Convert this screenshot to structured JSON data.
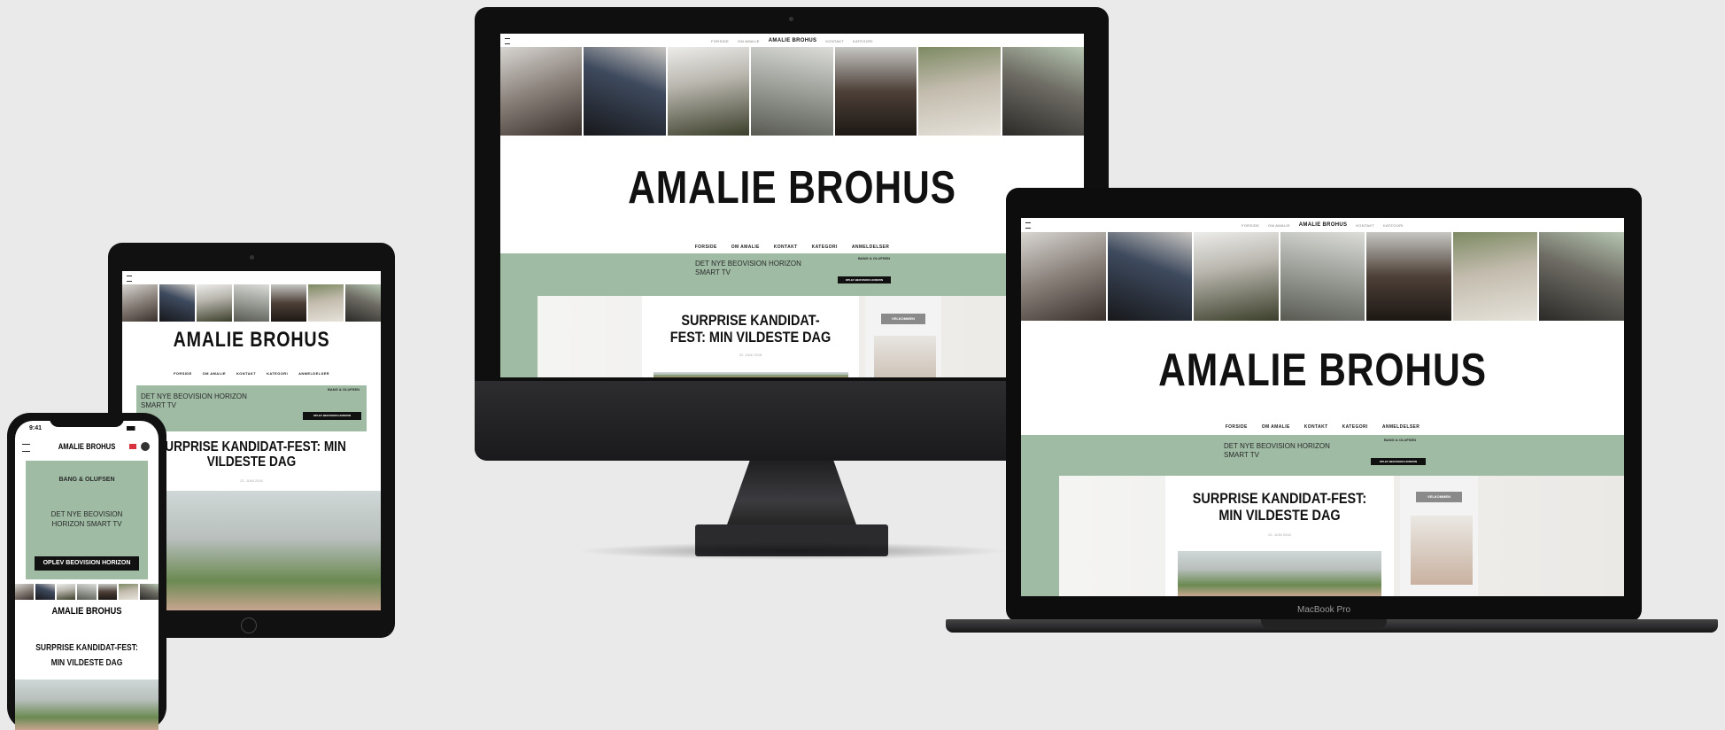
{
  "site": {
    "brand": "AMALIE BROHUS",
    "top_links": [
      "FORSIDE",
      "OM AMALIE",
      "AMALIE BROHUS",
      "KONTAKT",
      "KATEGORI"
    ],
    "nav": [
      "FORSIDE",
      "OM AMALIE",
      "KONTAKT",
      "KATEGORI",
      "ANMELDELSER"
    ],
    "ad": {
      "sponsor": "BANG & OLUFSEN",
      "text": "DET NYE BEOVISION HORIZON SMART TV",
      "button": "OPLEV BEOVISION HORIZON"
    },
    "post": {
      "title": "SURPRISE KANDIDAT-FEST: MIN VILDESTE DAG",
      "date": "22. JUNI 2018"
    },
    "sidebar_tag": "VELKOMMEN"
  },
  "phone": {
    "time": "9:41",
    "brand": "AMALIE BROHUS",
    "footer_brand": "AMALIE BROHUS"
  },
  "laptop": {
    "model": "MacBook Pro"
  },
  "colors": {
    "background": "#eaeaea",
    "ad_green": "#9fbba4",
    "device_black": "#0d0d0d"
  }
}
